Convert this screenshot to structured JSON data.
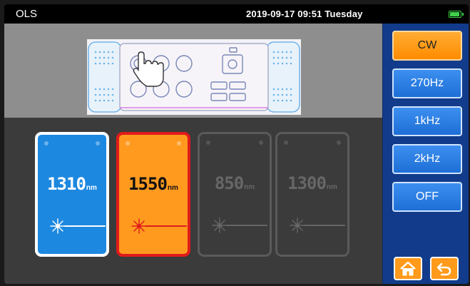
{
  "status_bar": {
    "app_title": "OLS",
    "datetime": "2019-09-17  09:51 Tuesday",
    "battery_icon": "battery-icon",
    "battery_level": 0.9,
    "battery_color": "#3fd14a"
  },
  "modes": {
    "items": [
      {
        "label": "CW",
        "active": true
      },
      {
        "label": "270Hz",
        "active": false
      },
      {
        "label": "1kHz",
        "active": false
      },
      {
        "label": "2kHz",
        "active": false
      },
      {
        "label": "OFF",
        "active": false
      }
    ],
    "active_color": "#ff9a1a",
    "inactive_color": "#1e6fd6"
  },
  "nav": {
    "home_icon": "home-icon",
    "back_icon": "back-arrow-icon"
  },
  "device": {
    "icon": "device-front-panel-with-tap-hand-icon"
  },
  "wavelengths": [
    {
      "value": "1310",
      "unit": "nm",
      "state": "enabled",
      "color": "#1d88e0"
    },
    {
      "value": "1550",
      "unit": "nm",
      "state": "selected",
      "color": "#ff9a1f"
    },
    {
      "value": "850",
      "unit": "nm",
      "state": "disabled",
      "color": "#3b3b3b"
    },
    {
      "value": "1300",
      "unit": "nm",
      "state": "disabled",
      "color": "#3b3b3b"
    }
  ],
  "laser_icon": "laser-beam-icon"
}
